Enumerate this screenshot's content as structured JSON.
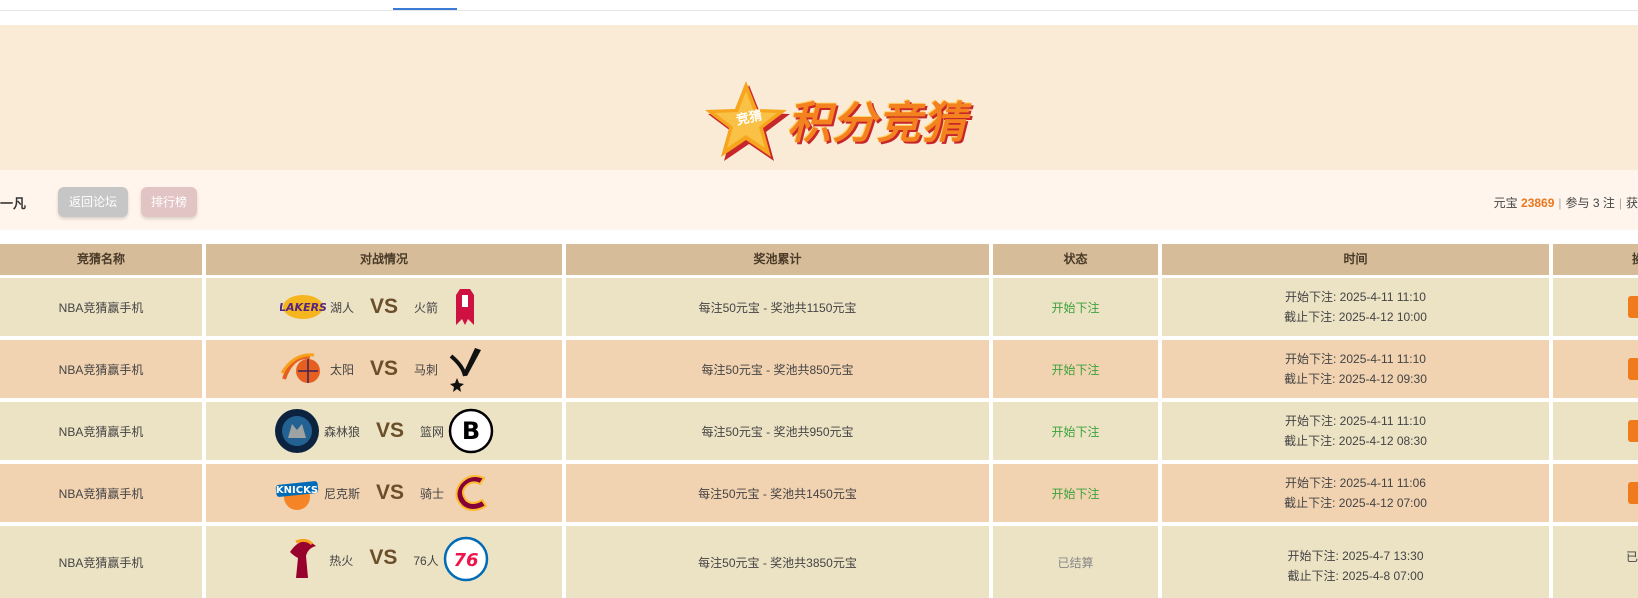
{
  "header": {
    "brand_icon_label": "竞猜",
    "brand_title": "积分竞猜"
  },
  "user": {
    "name": "一凡",
    "back_label": "返回论坛",
    "rank_label": "排行榜",
    "yuanbao_label": "元宝",
    "yuanbao_value": "23869",
    "joined_text": "参与 3 注",
    "trailing_text": "获"
  },
  "table": {
    "columns": [
      "竞猜名称",
      "对战情况",
      "奖池累计",
      "状态",
      "时间",
      "操"
    ],
    "rows": [
      {
        "name": "NBA竞猜赢手机",
        "home": "湖人",
        "home_icon": "lakers-logo-icon",
        "vs": "VS",
        "away": "火箭",
        "away_icon": "rockets-logo-icon",
        "pool": "每注50元宝 - 奖池共1150元宝",
        "status": "开始下注",
        "start": "开始下注: 2025-4-11 11:10",
        "end": "截止下注: 2025-4-12 10:00"
      },
      {
        "name": "NBA竞猜赢手机",
        "home": "太阳",
        "home_icon": "suns-logo-icon",
        "vs": "VS",
        "away": "马刺",
        "away_icon": "spurs-logo-icon",
        "pool": "每注50元宝 - 奖池共850元宝",
        "status": "开始下注",
        "start": "开始下注: 2025-4-11 11:10",
        "end": "截止下注: 2025-4-12 09:30"
      },
      {
        "name": "NBA竞猜赢手机",
        "home": "森林狼",
        "home_icon": "timberwolves-logo-icon",
        "vs": "VS",
        "away": "篮网",
        "away_icon": "nets-logo-icon",
        "pool": "每注50元宝 - 奖池共950元宝",
        "status": "开始下注",
        "start": "开始下注: 2025-4-11 11:10",
        "end": "截止下注: 2025-4-12 08:30"
      },
      {
        "name": "NBA竞猜赢手机",
        "home": "尼克斯",
        "home_icon": "knicks-logo-icon",
        "vs": "VS",
        "away": "骑士",
        "away_icon": "cavaliers-logo-icon",
        "pool": "每注50元宝 - 奖池共1450元宝",
        "status": "开始下注",
        "start": "开始下注: 2025-4-11 11:06",
        "end": "截止下注: 2025-4-12 07:00"
      },
      {
        "name": "NBA竞猜赢手机",
        "home": "热火",
        "home_icon": "heat-logo-icon",
        "vs": "VS",
        "away": "76人",
        "away_icon": "76ers-logo-icon",
        "pool": "每注50元宝 - 奖池共3850元宝",
        "status": "已结算",
        "start": "开始下注: 2025-4-7 13:30",
        "end": "截止下注: 2025-4-8 07:00",
        "action_text": "已"
      }
    ]
  },
  "colors": {
    "accent": "#f07b1d",
    "open_status": "#3aa33a",
    "header_bg": "#d6bc99",
    "row_odd": "#ece2c4",
    "row_even": "#f1d2b1"
  }
}
